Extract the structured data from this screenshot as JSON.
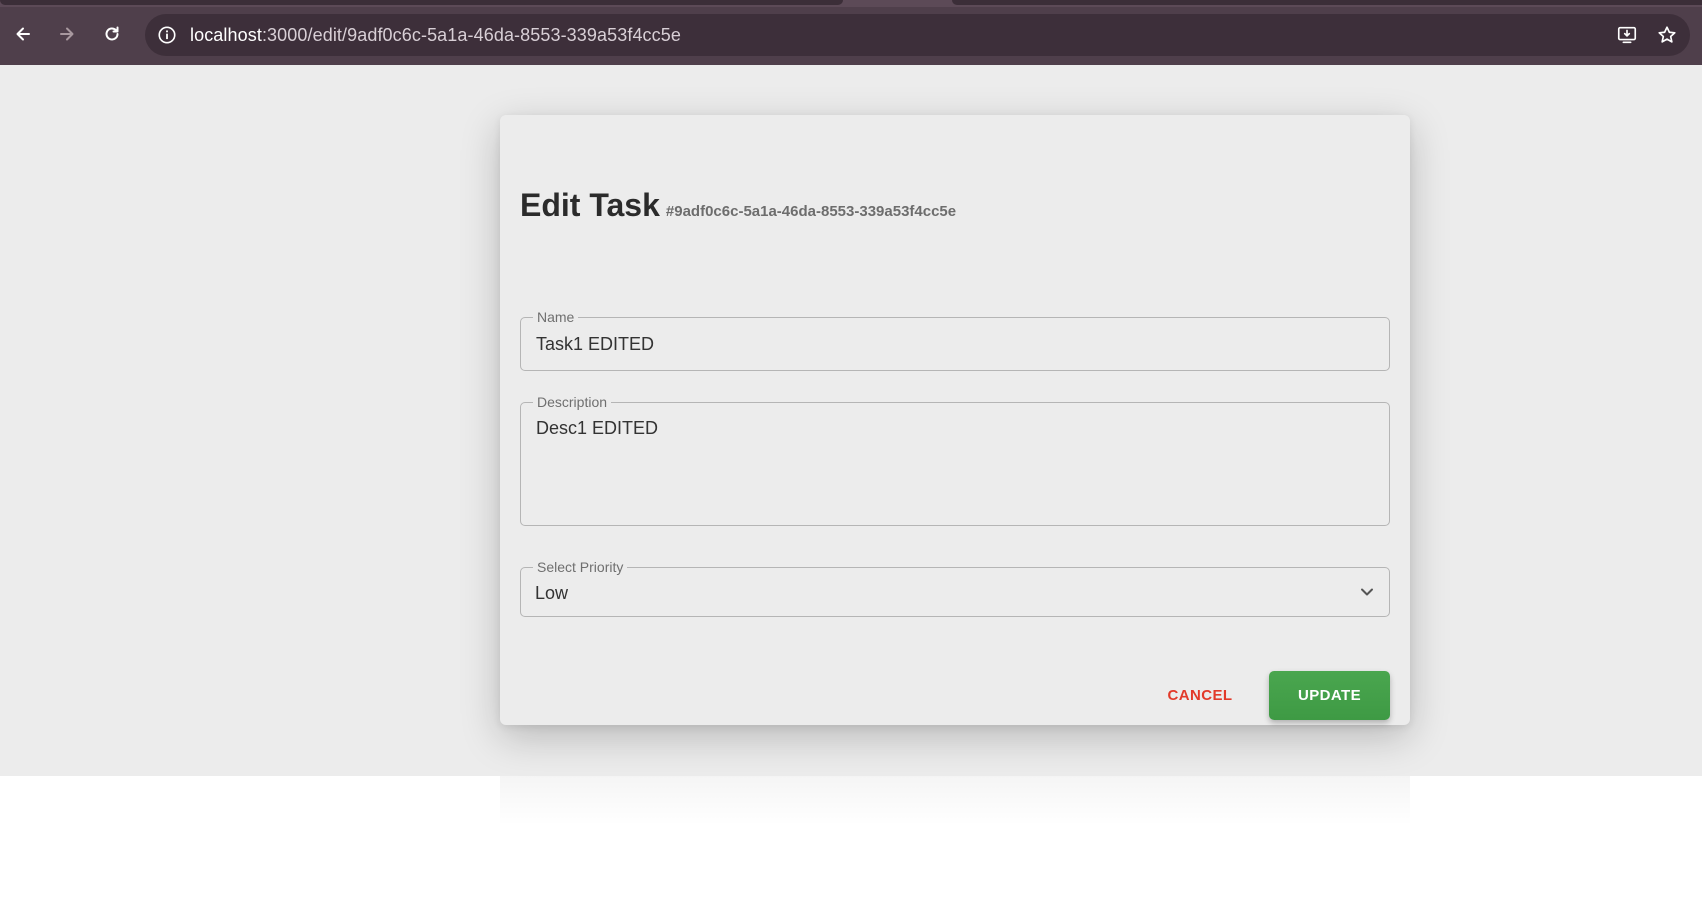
{
  "browser": {
    "url_host": "localhost",
    "url_path": ":3000/edit/9adf0c6c-5a1a-46da-8553-339a53f4cc5e",
    "icons": {
      "back": "arrow-left-icon",
      "forward": "arrow-right-icon",
      "reload": "reload-icon",
      "site_info": "info-icon",
      "install": "install-app-icon",
      "bookmark": "star-icon"
    }
  },
  "form": {
    "title": "Edit Task",
    "task_id": "#9adf0c6c-5a1a-46da-8553-339a53f4cc5e",
    "name": {
      "label": "Name",
      "value": "Task1 EDITED"
    },
    "description": {
      "label": "Description",
      "value": "Desc1 EDITED"
    },
    "priority": {
      "label": "Select Priority",
      "value": "Low"
    },
    "cancel_label": "CANCEL",
    "update_label": "UPDATE"
  },
  "colors": {
    "chrome": "#4f3f4b",
    "page_background": "#ececec",
    "update_button": "#43a047",
    "cancel_text": "#e23a2a"
  }
}
